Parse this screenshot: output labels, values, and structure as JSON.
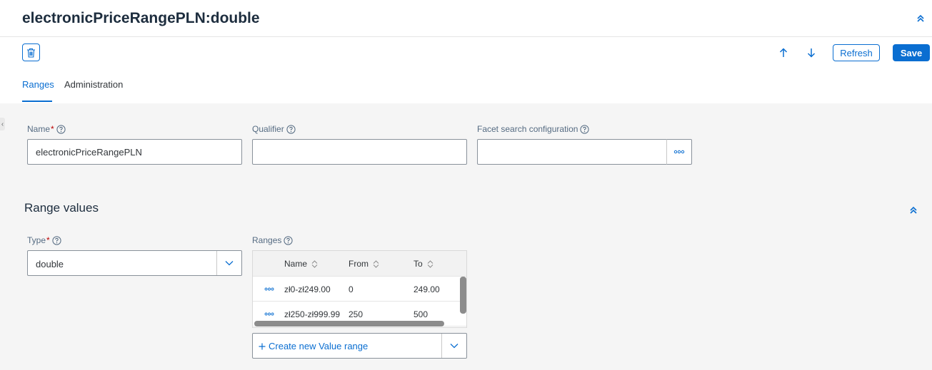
{
  "header": {
    "title": "electronicPriceRangePLN:double",
    "refresh_label": "Refresh",
    "save_label": "Save"
  },
  "tabs": [
    {
      "label": "Ranges",
      "selected": true
    },
    {
      "label": "Administration",
      "selected": false
    }
  ],
  "fields": {
    "name": {
      "label": "Name",
      "required_mark": "*",
      "value": "electronicPriceRangePLN"
    },
    "qualifier": {
      "label": "Qualifier",
      "value": ""
    },
    "facet": {
      "label": "Facet search configuration",
      "value": ""
    }
  },
  "range_values": {
    "title": "Range values",
    "type": {
      "label": "Type",
      "required_mark": "*",
      "value": "double"
    },
    "ranges": {
      "label": "Ranges",
      "columns": [
        "Name",
        "From",
        "To"
      ],
      "rows": [
        {
          "name": "zł0-zł249.00",
          "from": "0",
          "to": "249.00"
        },
        {
          "name": "zł250-zł999.99",
          "from": "250",
          "to": "500"
        }
      ]
    },
    "create_label": "Create new Value range"
  },
  "icons": {
    "delete": "trash-icon",
    "move_up": "arrow-up-icon",
    "move_down": "arrow-down-icon",
    "collapse": "double-chevron-up-icon",
    "help": "question-circle-icon",
    "value_help": "more-dots-icon",
    "dropdown": "chevron-down-icon",
    "sort": "sort-icon",
    "add": "plus-icon"
  },
  "colors": {
    "accent": "#0a6ed1",
    "required": "#bb0000",
    "background": "#f5f5f5"
  }
}
